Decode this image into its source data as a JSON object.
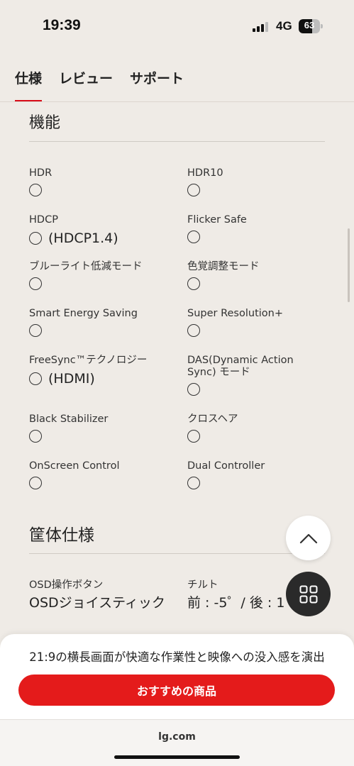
{
  "status_bar": {
    "time": "19:39",
    "network": "4G",
    "battery_level": "63",
    "battery_fraction": 0.63
  },
  "tabs": [
    {
      "label": "仕様"
    },
    {
      "label": "レビュー"
    },
    {
      "label": "サポート"
    }
  ],
  "sections": {
    "functions": {
      "title": "機能",
      "items": [
        {
          "label": "HDR",
          "value": ""
        },
        {
          "label": "HDR10",
          "value": ""
        },
        {
          "label": "HDCP",
          "value": "(HDCP1.4)"
        },
        {
          "label": "Flicker Safe",
          "value": ""
        },
        {
          "label": "ブルーライト低減モード",
          "value": ""
        },
        {
          "label": "色覚調整モード",
          "value": ""
        },
        {
          "label": "Smart Energy Saving",
          "value": ""
        },
        {
          "label": "Super Resolution+",
          "value": ""
        },
        {
          "label": "FreeSync™テクノロジー",
          "value": "(HDMI)"
        },
        {
          "label": "DAS(Dynamic Action Sync) モード",
          "value": ""
        },
        {
          "label": "Black Stabilizer",
          "value": ""
        },
        {
          "label": "クロスヘア",
          "value": ""
        },
        {
          "label": "OnScreen Control",
          "value": ""
        },
        {
          "label": "Dual Controller",
          "value": ""
        }
      ]
    },
    "housing": {
      "title": "筐体仕様",
      "items": [
        {
          "label": "OSD操作ボタン",
          "value": "OSDジョイスティック"
        },
        {
          "label": "チルト",
          "value": "前 : -5゜/ 後 : 1"
        }
      ]
    }
  },
  "bottom_sheet": {
    "promo_text": "21:9の横長画面が快適な作業性と映像への没入感を演出",
    "cta_label": "おすすめの商品",
    "cta_color": "#e41b1b"
  },
  "browser": {
    "url": "lg.com"
  },
  "colors": {
    "background": "#efebe6",
    "accent": "#d80c18"
  },
  "icons": {
    "scroll_top": "chevron-up-icon",
    "menu": "grid-icon"
  }
}
